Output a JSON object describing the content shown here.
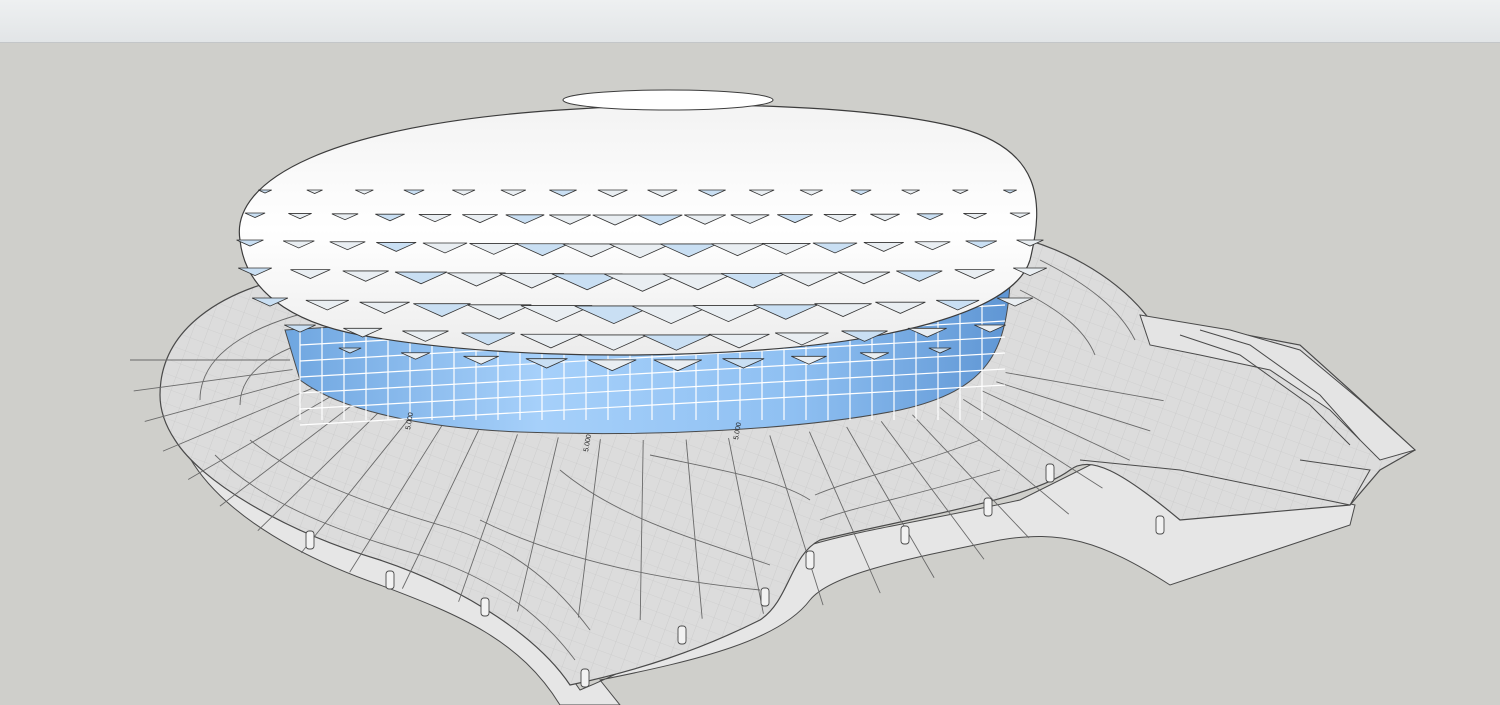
{
  "window": {
    "toolbar_label": ""
  },
  "viewport": {
    "background_color": "#cfcfcb",
    "model": {
      "roof_color": "#ffffff",
      "glass_color": "#8fc0f2",
      "plaza_color": "#d9d9d9",
      "edge_color": "#4a4a4a"
    },
    "labels": {
      "elev_1": "5.000",
      "elev_2": "5.000",
      "elev_3": "5.000"
    }
  }
}
